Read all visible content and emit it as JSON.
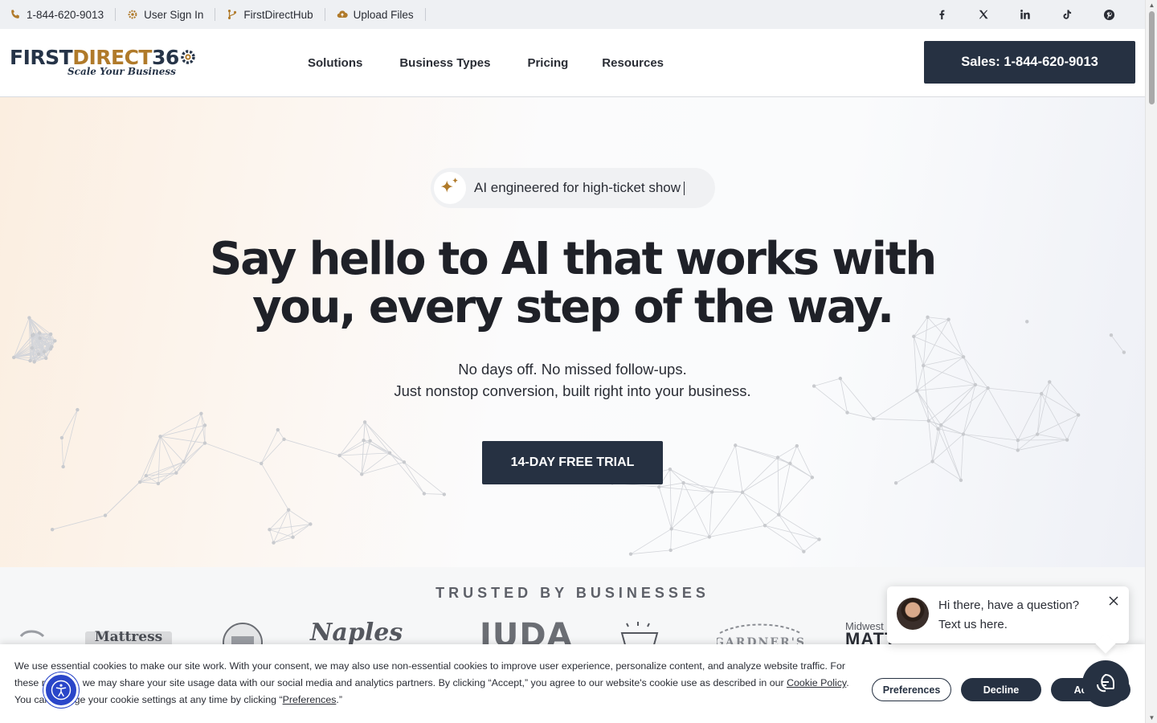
{
  "topbar": {
    "items": [
      {
        "icon": "phone-icon",
        "label": "1-844-620-9013"
      },
      {
        "icon": "gear-icon",
        "label": "User Sign In"
      },
      {
        "icon": "branch-icon",
        "label": "FirstDirectHub"
      },
      {
        "icon": "cloud-upload-icon",
        "label": "Upload Files"
      }
    ],
    "socials": [
      "facebook-icon",
      "x-icon",
      "linkedin-icon",
      "tiktok-icon",
      "pinterest-icon"
    ]
  },
  "logo": {
    "part1": "FIRST",
    "part2": "DIRECT",
    "part3": "36",
    "tagline": "Scale Your Business"
  },
  "nav": {
    "items": [
      "Solutions",
      "Business Types",
      "Pricing",
      "Resources"
    ],
    "sales_button": "Sales: 1-844-620-9013"
  },
  "hero": {
    "pill_text": "AI engineered for high-ticket show",
    "headline_line1": "Say hello to AI that works with",
    "headline_line2": "you, every step of the way.",
    "sub_line1": "No days off. No missed follow-ups.",
    "sub_line2": "Just nonstop conversion, built right into your business.",
    "cta": "14-DAY FREE TRIAL"
  },
  "trusted": {
    "title": "TRUSTED BY BUSINESSES",
    "logos": [
      "Mattress",
      "Naples",
      "IUDA",
      "GARDNER'S",
      "Midwest",
      "MATT"
    ]
  },
  "cookie": {
    "text_1": "We use essential cookies to make our site work. With your consent, we may also use non-essential cookies to improve user experience, personalize content, and analyze website traffic. For these reasons, we may share your site usage data with our social media and analytics partners. By clicking “Accept,” you agree to our website's cookie use as described in our ",
    "policy_link": "Cookie Policy",
    "text_2": ". You can change your cookie settings at any time by clicking “",
    "pref_link": "Preferences",
    "text_3": ".”",
    "btn_preferences": "Preferences",
    "btn_decline": "Decline",
    "btn_accept": "Accept"
  },
  "chat": {
    "line1": "Hi there, have a question?",
    "line2": "Text us here."
  },
  "colors": {
    "brand_dark": "#263142",
    "brand_gold": "#b07a2a",
    "a11y_blue": "#2a46c9"
  }
}
